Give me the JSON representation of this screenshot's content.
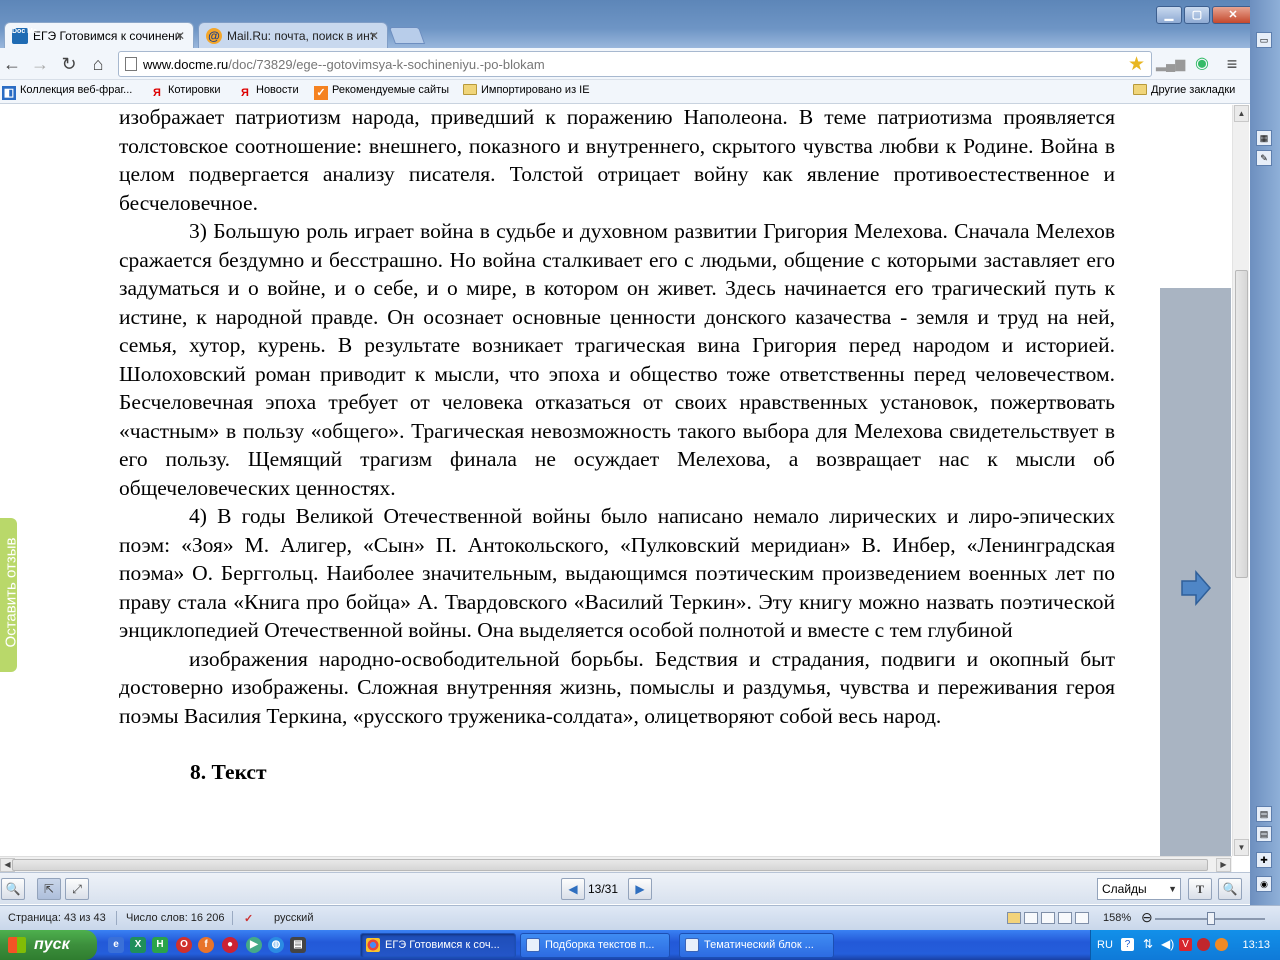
{
  "browser": {
    "tabs": [
      {
        "title": "ЕГЭ Готовимся к сочинени",
        "favicon": "Doc Me",
        "active": true
      },
      {
        "title": "Mail.Ru: почта, поиск в инт",
        "favicon": "@",
        "active": false
      }
    ],
    "url_domain": "www.docme.ru",
    "url_path": "/doc/73829/ege--gotovimsya-k-sochineniyu.-po-blokam",
    "bookmarks": [
      "Коллекция веб-фраг...",
      "Котировки",
      "Новости",
      "Рекомендуемые сайты",
      "Импортировано из IE"
    ],
    "other_bookmarks": "Другие закладки"
  },
  "document": {
    "paragraphs": [
      {
        "text": "изображает патриотизм народа, приведший к поражению Наполеона. В теме патриотизма проявляется толстовское соотношение: внешнего, показного и внутреннего, скрытого чувства любви к Родине. Война в целом подвергается анализу писателя. Толстой отрицает войну как явление противоестественное и бесчеловечное."
      },
      {
        "text": "3) Большую роль играет война в судьбе и духовном развитии Григория Мелехова. Сначала Мелехов сражается бездумно и бесстрашно. Но война сталкивает его с людьми, общение с которыми заставляет его задуматься и о войне, и о себе, и о мире, в котором он живет. Здесь начинается его трагический путь к истине, к народной правде. Он осознает основные ценности донского казачества - земля и труд на ней, семья, хутор, курень. В результате возникает трагическая вина Григория перед народом и историей. Шолоховский роман приводит к мысли, что эпоха и общество тоже ответственны перед человечеством. Бесчеловечная эпоха требует от человека отказаться от своих нравственных установок, пожертвовать «частным» в пользу «общего». Трагическая невозможность такого выбора для Мелехова свидетельствует в его пользу. Щемящий трагизм финала не осуждает Мелехова, а возвращает нас к мысли об общечеловеческих ценностях."
      },
      {
        "text": "4) В годы Великой Отечественной войны было написано немало лирических и лиро-эпических поэм: «Зоя» М. Алигер, «Сын» П. Антокольского, «Пулковский меридиан» В. Инбер, «Ленинградская поэма» О. Берггольц. Наиболее значительным, выдающимся поэтическим произведением военных лет по праву стала «Книга про бойца» А. Твардовского «Василий Теркин». Эту книгу можно назвать поэтической энциклопедией Отечественной войны. Она выделяется особой полнотой и вместе с тем глубиной"
      },
      {
        "text": "изображения народно-освободительной борьбы. Бедствия и страдания, подвиги и окопный быт достоверно изображены. Сложная внутренняя жизнь, помыслы и раздумья, чувства и переживания героя поэмы Василия Теркина, «русского труженика-солдата», олицетворяют собой весь народ."
      }
    ],
    "next_heading": "8. Текст"
  },
  "feedback_label": "Оставить отзыв",
  "viewer": {
    "page_indicator": "13/31",
    "view_mode": "Слайды"
  },
  "statusbar": {
    "page": "Страница: 43 из 43",
    "words": "Число слов: 16 206",
    "language": "русский",
    "zoom": "158%"
  },
  "taskbar": {
    "start_label": "пуск",
    "tasks": [
      {
        "label": "ЕГЭ Готовимся к соч...",
        "active": true
      },
      {
        "label": "Подборка текстов п...",
        "active": false
      },
      {
        "label": "Тематический блок ...",
        "active": false
      }
    ],
    "lang": "RU",
    "clock": "13:13"
  },
  "colors": {
    "titlebar": "#6e95c5",
    "next_panel": "#a9b4c2",
    "feedback_tab": "#b9d86a",
    "next_arrow": "#4f86c6",
    "taskbar": "#245edb",
    "start_button": "#3c8f3c"
  }
}
